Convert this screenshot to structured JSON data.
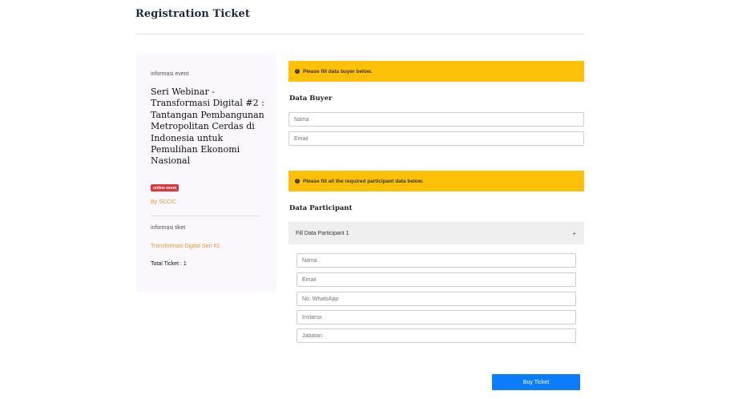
{
  "header": {
    "title": "Registration Ticket"
  },
  "event_card": {
    "event_section_label": "informasi event",
    "event_title": "Seri Webinar - Transformasi Digital #2 : Tantangan Pembangunan Metropolitan Cerdas di Indonesia untuk Pemulihan Ekonomi Nasional",
    "badge": "online event",
    "organizer": "By SCCIC",
    "ticket_section_label": "informasi tiket",
    "ticket_name": "Transformasi Digital Seri #2",
    "total_ticket": "Total Ticket : 1"
  },
  "buyer": {
    "alert": "Please fill data buyer below.",
    "heading": "Data Buyer",
    "name_placeholder": "Nama",
    "email_placeholder": "Email"
  },
  "participant": {
    "alert": "Please fill all the required participant data below.",
    "heading": "Data Participant",
    "accordion_label": "Fill Data Participant 1",
    "accordion_toggle": "+",
    "fields": {
      "name_placeholder": "Nama",
      "email_placeholder": "Email",
      "whatsapp_placeholder": "No. WhatsApp",
      "instansi_placeholder": "Instansi",
      "jabatan_placeholder": "Jabatan"
    }
  },
  "actions": {
    "buy_label": "Buy Ticket"
  },
  "colors": {
    "alert_bg": "#ffc107",
    "primary_button": "#0b7dfa",
    "badge_bg": "#d9363e",
    "accent_text": "#e89a25",
    "card_bg": "#faf7fd"
  }
}
